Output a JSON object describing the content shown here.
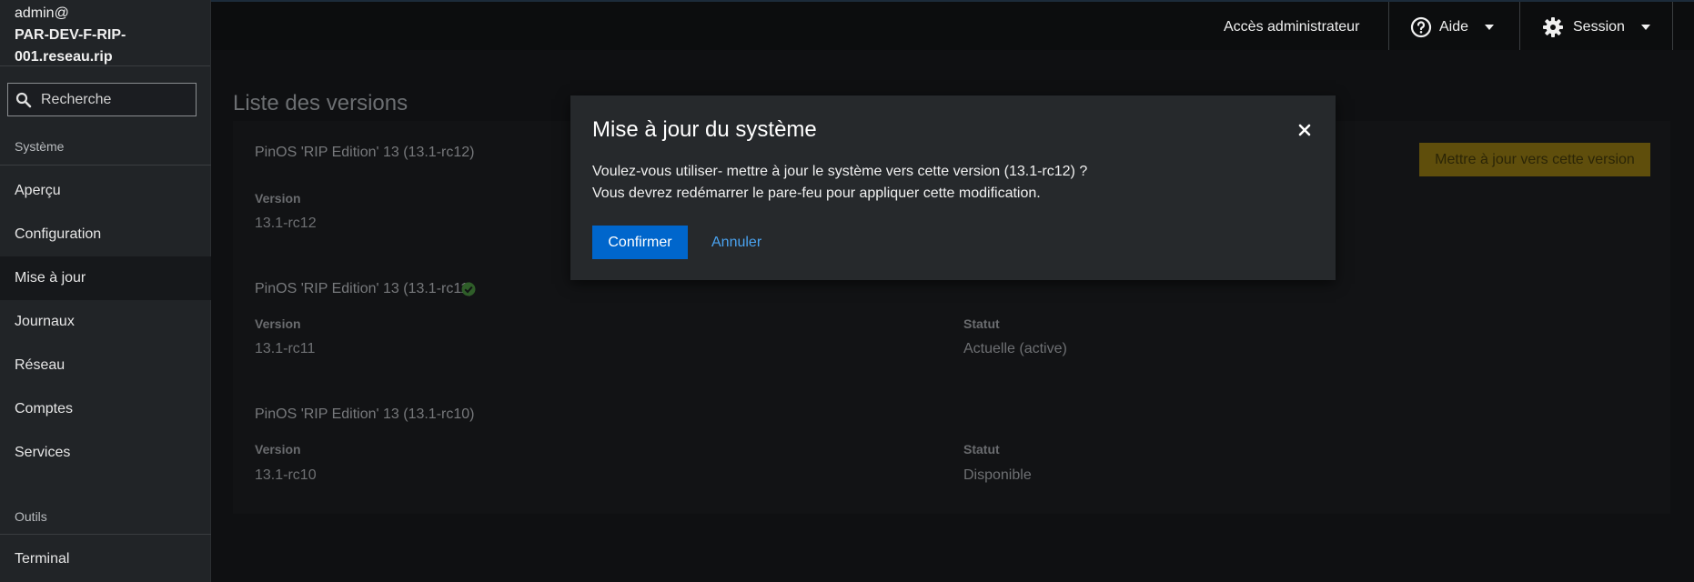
{
  "sidebar": {
    "host_user": "admin@",
    "host_name_line1": "PAR-DEV-F-RIP-",
    "host_name_line2": "001.reseau.rip",
    "search_placeholder": "Recherche",
    "section_system": "Système",
    "items": [
      {
        "label": "Aperçu"
      },
      {
        "label": "Configuration"
      },
      {
        "label": "Mise à jour"
      },
      {
        "label": "Journaux"
      },
      {
        "label": "Réseau"
      },
      {
        "label": "Comptes"
      },
      {
        "label": "Services"
      }
    ],
    "section_tools": "Outils",
    "tools": [
      {
        "label": "Terminal"
      }
    ]
  },
  "topbar": {
    "admin_access": "Accès administrateur",
    "help": "Aide",
    "session": "Session"
  },
  "page": {
    "title": "Liste des versions",
    "update_button": "Mettre à jour vers cette version",
    "versions": [
      {
        "title": "PinOS 'RIP Edition' 13 (13.1-rc12)",
        "version_label": "Version",
        "version": "13.1-rc12"
      },
      {
        "title": "PinOS 'RIP Edition' 13 (13.1-rc11)",
        "version_label": "Version",
        "version": "13.1-rc11",
        "status_label": "Statut",
        "status": "Actuelle (active)"
      },
      {
        "title": "PinOS 'RIP Edition' 13 (13.1-rc10)",
        "version_label": "Version",
        "version": "13.1-rc10",
        "status_label": "Statut",
        "status": "Disponible"
      }
    ]
  },
  "modal": {
    "title": "Mise à jour du système",
    "line1": "Voulez-vous utiliser- mettre à jour le système vers cette version (13.1-rc12) ?",
    "line2": "Vous devrez redémarrer le pare-feu pour appliquer cette modification.",
    "confirm": "Confirmer",
    "cancel": "Annuler"
  },
  "colors": {
    "primary": "#0066cc",
    "link": "#4aa3f0",
    "warning": "#f0ab00",
    "success": "#3e8635"
  }
}
